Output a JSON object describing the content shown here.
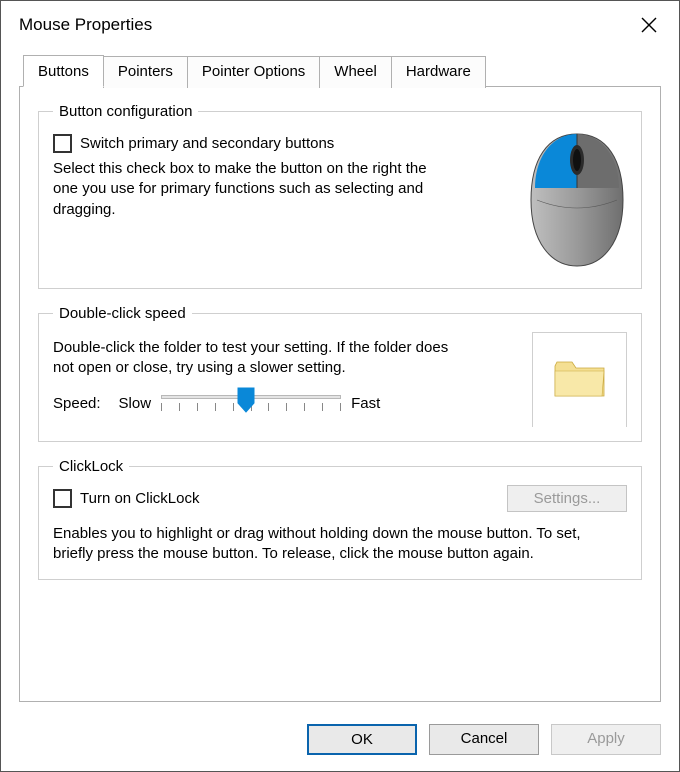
{
  "window": {
    "title": "Mouse Properties"
  },
  "tabs": {
    "buttons": "Buttons",
    "pointers": "Pointers",
    "pointer_options": "Pointer Options",
    "wheel": "Wheel",
    "hardware": "Hardware"
  },
  "button_config": {
    "legend": "Button configuration",
    "switch_label": "Switch primary and secondary buttons",
    "desc": "Select this check box to make the button on the right the one you use for primary functions such as selecting and dragging."
  },
  "double_click": {
    "legend": "Double-click speed",
    "desc": "Double-click the folder to test your setting. If the folder does not open or close, try using a slower setting.",
    "speed_label": "Speed:",
    "slow_label": "Slow",
    "fast_label": "Fast"
  },
  "clicklock": {
    "legend": "ClickLock",
    "turn_on_label": "Turn on ClickLock",
    "settings_label": "Settings...",
    "desc": "Enables you to highlight or drag without holding down the mouse button. To set, briefly press the mouse button. To release, click the mouse button again."
  },
  "footer": {
    "ok": "OK",
    "cancel": "Cancel",
    "apply": "Apply"
  },
  "colors": {
    "accent": "#0a88d8"
  }
}
